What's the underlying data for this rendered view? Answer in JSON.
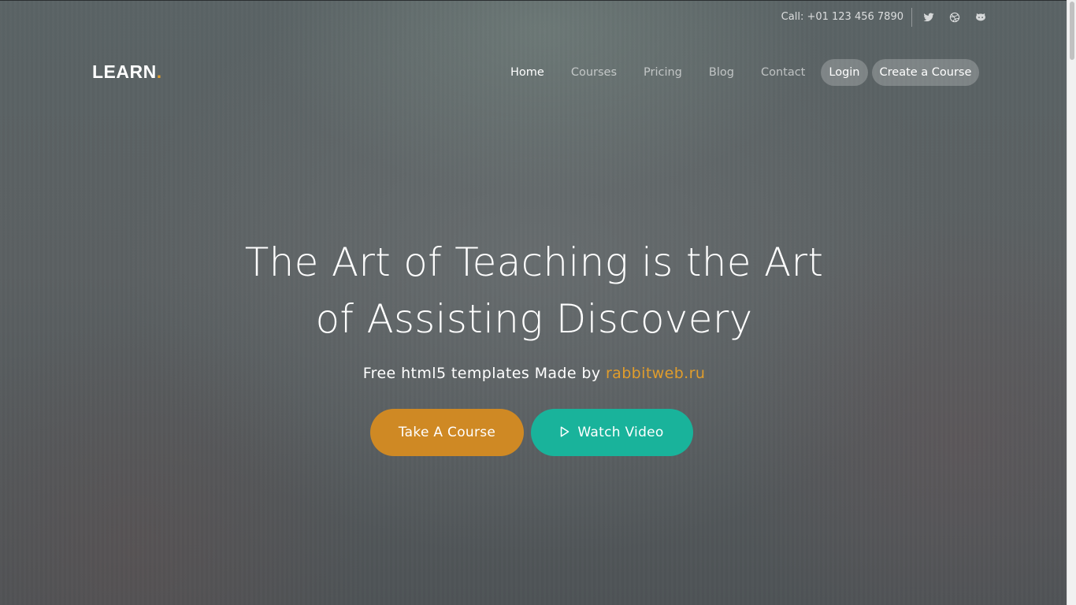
{
  "topbar": {
    "phone": "Call: +01 123 456 7890",
    "social_icons": [
      "twitter-icon",
      "dribbble-icon",
      "github-icon"
    ]
  },
  "header": {
    "logo_text": "LEARN",
    "logo_dot": ".",
    "nav": {
      "home": "Home",
      "courses": "Courses",
      "pricing": "Pricing",
      "blog": "Blog",
      "contact": "Contact",
      "login": "Login",
      "create": "Create a Course"
    }
  },
  "hero": {
    "title_line1": "The Art of Teaching is the Art",
    "title_line2": "of Assisting Discovery",
    "subtitle_prefix": "Free html5 templates Made by ",
    "subtitle_link": "rabbitweb.ru",
    "primary_button": "Take A Course",
    "secondary_button": "Watch Video",
    "secondary_icon": "play-icon"
  },
  "colors": {
    "accent_orange": "#cf8924",
    "accent_teal": "#19b39b",
    "link_orange": "#e19d2b"
  }
}
